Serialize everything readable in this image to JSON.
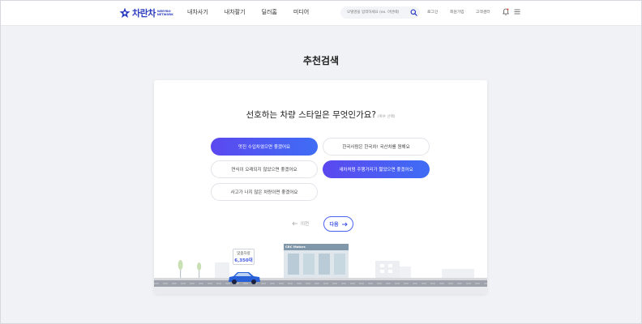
{
  "header": {
    "logo_text": "차란차",
    "logo_sub": "WEEYBO NETWORK",
    "nav": [
      "내차사기",
      "내차팔기",
      "딜러홈",
      "미디어"
    ],
    "search_placeholder": "모델명을 입력하세요 (ex. 아반떼)",
    "login": "로그인",
    "signup": "회원가입",
    "support": "고객센터"
  },
  "page_title": "추천검색",
  "question": {
    "text": "선호하는 차량 스타일은 무엇인가요?",
    "hint": "(복수 선택)"
  },
  "options": [
    {
      "label": "멋진 수입차였으면 좋겠어요",
      "selected": true
    },
    {
      "label": "한국사람은 한국차! 국산차를 원해요",
      "selected": false
    },
    {
      "label": "연식이 오래되지 않았으면 좋겠어요",
      "selected": false
    },
    {
      "label": "새차처럼 주행거리가 짧았으면 좋겠어요",
      "selected": true
    },
    {
      "label": "사고가 나지 않은 차량이면 좋겠어요",
      "selected": false
    }
  ],
  "nav_buttons": {
    "prev": "이전",
    "next": "다음"
  },
  "scene": {
    "badge_label": "맞춤차량",
    "badge_count": "6,350대",
    "building_sign": "CRC Motors"
  },
  "colors": {
    "accent_start": "#5b48ef",
    "accent_end": "#3f6df5",
    "brand": "#2b3cbf"
  }
}
